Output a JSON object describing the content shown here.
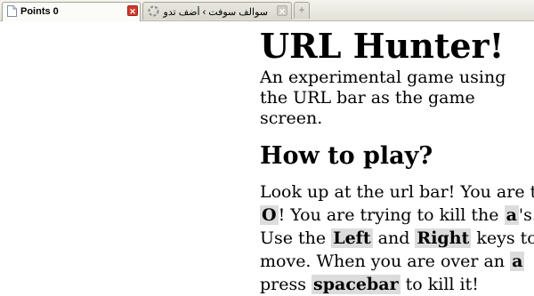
{
  "browser": {
    "tabs": [
      {
        "title": "Points 0",
        "active": true,
        "close_label": "✕"
      },
      {
        "title": "سوالف سوفت › أضف تدوينة جديد...",
        "active": false,
        "close_label": "✕"
      }
    ],
    "new_tab_label": "+"
  },
  "page": {
    "title": "URL Hunter!",
    "subtitle": "An experimental game using the URL bar as the game screen.",
    "howto_heading": "How to play?",
    "instructions": {
      "l1": "Look up at the url bar! You are the",
      "player_symbol": "O",
      "l2a": "! You are trying to kill the ",
      "enemy_symbol": "a",
      "l2b": "'s.",
      "l3a": "Use the ",
      "left_key": "Left",
      "l3b": " and ",
      "right_key": "Right",
      "l3c": " keys to",
      "l4a": "move. When you are over an ",
      "enemy_symbol2": "a",
      "l5a": "press ",
      "action_key": "spacebar",
      "l5b": " to kill it!"
    }
  },
  "colors": {
    "key_highlight": "#dcdcdc",
    "active_close": "#d13a2a"
  }
}
